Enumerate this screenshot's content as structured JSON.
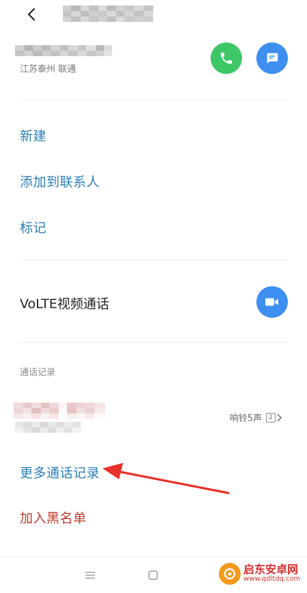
{
  "contact": {
    "location": "江苏泰州 联通"
  },
  "actions": {
    "new": "新建",
    "add_to_contacts": "添加到联系人",
    "mark": "标记"
  },
  "volte": {
    "label": "VoLTE视频通话"
  },
  "call_log": {
    "section_title": "通话记录",
    "entries": [
      {
        "status": "响铃5声",
        "sim": "2"
      }
    ],
    "more_label": "更多通话记录"
  },
  "blacklist": {
    "label": "加入黑名单"
  },
  "watermark": {
    "title": "启东安卓网",
    "url": "www.qdltdq.com"
  },
  "colors": {
    "accent_link": "#2d7fb8",
    "danger": "#c0392b",
    "call_green": "#3ec767",
    "action_blue": "#3d8ff0",
    "annotation_red": "#e8312a"
  }
}
